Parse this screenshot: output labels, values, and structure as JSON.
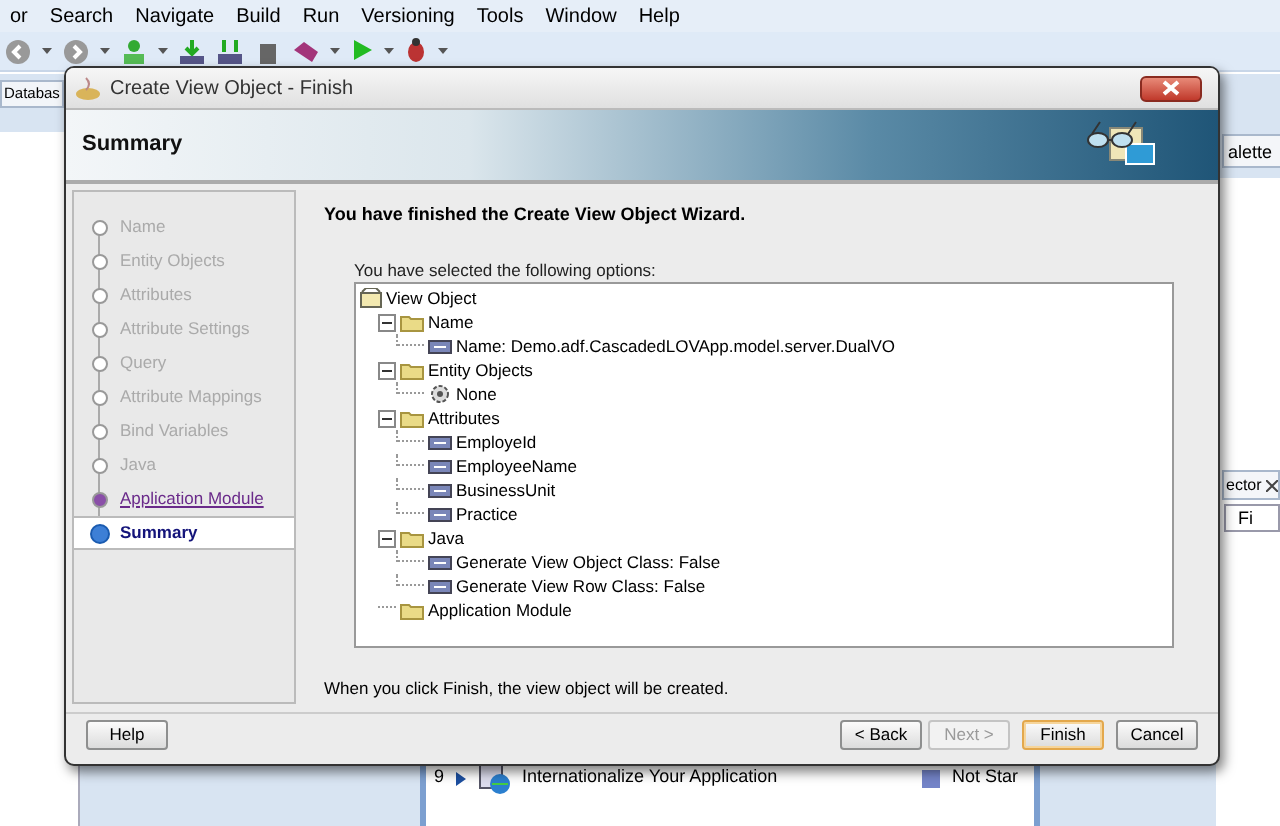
{
  "menu": [
    "or",
    "Search",
    "Navigate",
    "Build",
    "Run",
    "Versioning",
    "Tools",
    "Window",
    "Help"
  ],
  "ide_tabs": {
    "left": "Databas",
    "right": "alette"
  },
  "side_panel": {
    "tab": "ector",
    "field": "Fi"
  },
  "bottom_row": {
    "number": "9",
    "title": "Internationalize Your Application",
    "status": "Not Star"
  },
  "dialog": {
    "title": "Create View Object - Finish",
    "header": "Summary",
    "steps": [
      {
        "label": "Name",
        "selected": false,
        "enabled": false
      },
      {
        "label": "Entity Objects",
        "selected": false,
        "enabled": false
      },
      {
        "label": "Attributes",
        "selected": false,
        "enabled": false
      },
      {
        "label": "Attribute Settings",
        "selected": false,
        "enabled": false
      },
      {
        "label": "Query",
        "selected": false,
        "enabled": false
      },
      {
        "label": "Attribute Mappings",
        "selected": false,
        "enabled": false
      },
      {
        "label": "Bind Variables",
        "selected": false,
        "enabled": false
      },
      {
        "label": "Java",
        "selected": false,
        "enabled": false
      },
      {
        "label": "Application Module",
        "selected": false,
        "enabled": true
      },
      {
        "label": "Summary",
        "selected": true,
        "enabled": true
      }
    ],
    "heading": "You have finished the Create View Object Wizard.",
    "tree_caption": "You have selected the following options:",
    "tree": [
      {
        "label": "View Object",
        "kind": "root",
        "children": [
          {
            "label": "Name",
            "kind": "folder",
            "expanded": true,
            "children": [
              {
                "label": "Name: Demo.adf.CascadedLOVApp.model.server.DualVO",
                "kind": "attribute"
              }
            ]
          },
          {
            "label": "Entity Objects",
            "kind": "folder",
            "expanded": true,
            "children": [
              {
                "label": "None",
                "kind": "entity"
              }
            ]
          },
          {
            "label": "Attributes",
            "kind": "folder",
            "expanded": true,
            "children": [
              {
                "label": "EmployeId",
                "kind": "attribute"
              },
              {
                "label": "EmployeeName",
                "kind": "attribute"
              },
              {
                "label": "BusinessUnit",
                "kind": "attribute"
              },
              {
                "label": "Practice",
                "kind": "attribute"
              }
            ]
          },
          {
            "label": "Java",
            "kind": "folder",
            "expanded": true,
            "children": [
              {
                "label": "Generate View Object Class: False",
                "kind": "attribute"
              },
              {
                "label": "Generate View Row Class: False",
                "kind": "attribute"
              }
            ]
          },
          {
            "label": "Application Module",
            "kind": "folder"
          }
        ]
      }
    ],
    "footer_text": "When you click Finish, the view object will be created.",
    "buttons": [
      {
        "label": "Help",
        "kind": "help",
        "disabled": false,
        "default": false
      },
      {
        "label": "< Back",
        "kind": "nav",
        "disabled": false,
        "default": false
      },
      {
        "label": "Next >",
        "kind": "nav",
        "disabled": true,
        "default": false
      },
      {
        "label": "Finish",
        "kind": "nav",
        "disabled": false,
        "default": true
      },
      {
        "label": "Cancel",
        "kind": "nav",
        "disabled": false,
        "default": false
      }
    ]
  }
}
